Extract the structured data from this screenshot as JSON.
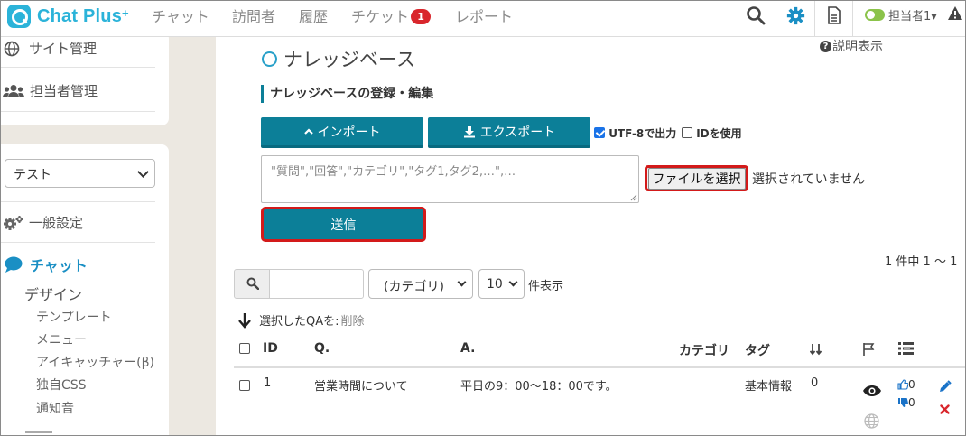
{
  "app": {
    "name": "Chat Plus",
    "mark": "+"
  },
  "nav": {
    "items": [
      "チャット",
      "訪問者",
      "履歴",
      "チケット",
      "レポート"
    ],
    "ticket_badge": "1",
    "agent": "担当者1▾"
  },
  "sidebar": {
    "site_admin": "サイト管理",
    "staff_admin": "担当者管理",
    "site_select": "テスト",
    "general": "一般設定",
    "chat": "チャット",
    "design": "デザイン",
    "sub_items": [
      "テンプレート",
      "メニュー",
      "アイキャッチャー(β)",
      "独自CSS",
      "通知音"
    ]
  },
  "page": {
    "title": "ナレッジベース",
    "help": "説明表示",
    "section": "ナレッジベースの登録・編集",
    "import_label": "インポート",
    "export_label": "エクスポート",
    "utf8_label": "UTF-8で出力",
    "utf8_checked": true,
    "id_label": "IDを使用",
    "id_checked": false,
    "textarea_placeholder": "\"質問\",\"回答\",\"カテゴリ\",\"タグ1,タグ2,…\",…",
    "file_button": "ファイルを選択",
    "no_file": "選択されていません",
    "send_label": "送信",
    "count": "1 件中 1 〜 1",
    "category_select": "(カテゴリ)",
    "perpage_select": "10",
    "perpage_label": "件表示",
    "bulk_label": "選択したQAを:",
    "bulk_delete": "削除"
  },
  "table": {
    "headers": {
      "id": "ID",
      "q": "Q.",
      "a": "A.",
      "category": "カテゴリ",
      "tag": "タグ"
    },
    "rows": [
      {
        "id": "1",
        "q": "営業時間について",
        "a": "平日の9：00〜18：00です。",
        "category": "",
        "tag": "基本情報",
        "order": "0",
        "likes": "0",
        "dislikes": "0"
      }
    ]
  },
  "colors": {
    "brand": "#2bb3d9",
    "teal": "#0c7f98",
    "highlight": "#d31a1a",
    "badge": "#d9262c"
  }
}
